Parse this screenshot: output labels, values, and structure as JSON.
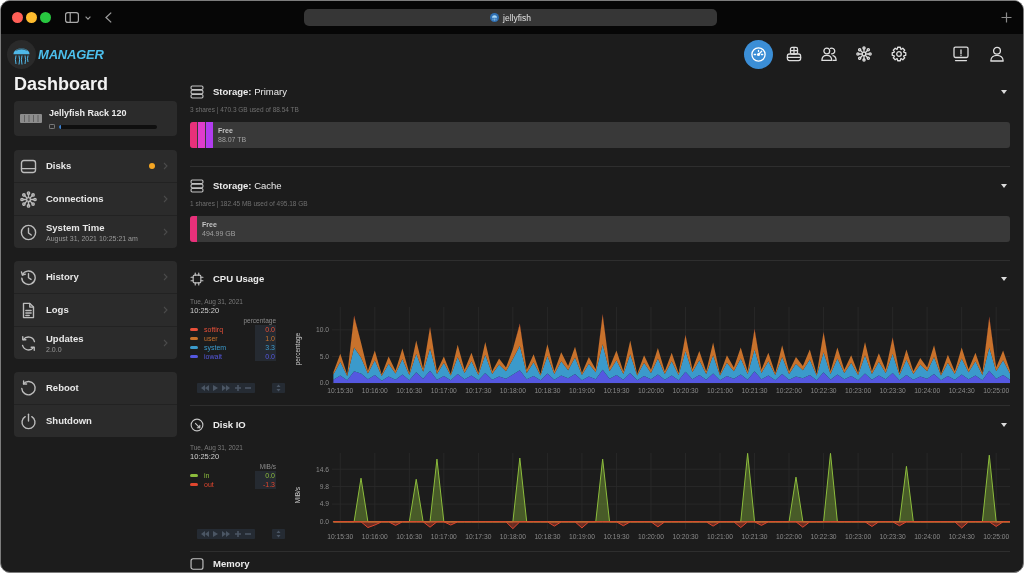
{
  "browser": {
    "url": "jellyfish"
  },
  "app": {
    "logo": "MANAGER"
  },
  "nav": [
    {
      "selected": true
    },
    {
      "selected": false
    },
    {
      "selected": false
    },
    {
      "selected": false
    },
    {
      "selected": false
    }
  ],
  "sidebar": {
    "title": "Dashboard",
    "device": {
      "name": "Jellyfish Rack 120",
      "level": 0.02
    },
    "groups": [
      {
        "kind": "nav",
        "items": [
          {
            "label": "Disks",
            "alert": true
          },
          {
            "label": "Connections",
            "alert": false
          },
          {
            "label": "System Time",
            "detail": "August 31, 2021 10:25:21 am",
            "alert": false
          }
        ]
      },
      {
        "kind": "nav",
        "items": [
          {
            "label": "History",
            "alert": false
          },
          {
            "label": "Logs",
            "alert": false
          },
          {
            "label": "Updates",
            "detail": "2.0.0",
            "alert": false
          }
        ]
      },
      {
        "kind": "action",
        "items": [
          {
            "label": "Reboot",
            "alert": false
          },
          {
            "label": "Shutdown",
            "alert": false
          }
        ]
      }
    ]
  },
  "sections": [
    {
      "kind": "storage",
      "title": "**Storage:** Primary",
      "summary": "3 shares | 470.3 GB used of 88.54 TB",
      "segments": [
        {
          "color": "#e8307a"
        },
        {
          "color": "#e03ccc"
        },
        {
          "color": "#b23cf0"
        }
      ],
      "free_label": "Free",
      "free_value": "88.07 TB"
    },
    {
      "kind": "storage",
      "title": "**Storage:** Cache",
      "summary": "1 shares | 182.45 MB used of 495.18 GB",
      "segments": [
        {
          "color": "#e8307a"
        }
      ],
      "free_label": "Free",
      "free_value": "494.99 GB"
    },
    {
      "kind": "chart",
      "title": "CPU Usage",
      "date": "Tue, Aug 31, 2021",
      "time": "10:25:20",
      "unit": "percentage",
      "readings": [
        "0.0",
        "1.0",
        "3.3",
        "0.0"
      ],
      "chart_data": {
        "type": "area",
        "ylabel": "percentage",
        "stacked": true,
        "grid": true,
        "ylim": [
          0,
          14.3
        ],
        "yticks": [
          {
            "value": 0,
            "label": "0.0"
          },
          {
            "value": 5,
            "label": "5.0"
          },
          {
            "value": 10,
            "label": "10.0"
          }
        ],
        "categories": [
          null,
          "10:15:30",
          null,
          null,
          null,
          null,
          "10:16:00",
          null,
          null,
          null,
          null,
          "10:16:30",
          null,
          null,
          null,
          null,
          "10:17:00",
          null,
          null,
          null,
          null,
          "10:17:30",
          null,
          null,
          null,
          null,
          "10:18:00",
          null,
          null,
          null,
          null,
          "10:18:30",
          null,
          null,
          null,
          null,
          "10:19:00",
          null,
          null,
          null,
          null,
          "10:19:30",
          null,
          null,
          null,
          null,
          "10:20:00",
          null,
          null,
          null,
          null,
          "10:20:30",
          null,
          null,
          null,
          null,
          "10:21:00",
          null,
          null,
          null,
          null,
          "10:21:30",
          null,
          null,
          null,
          null,
          "10:22:00",
          null,
          null,
          null,
          null,
          "10:22:30",
          null,
          null,
          null,
          null,
          "10:23:00",
          null,
          null,
          null,
          null,
          "10:23:30",
          null,
          null,
          null,
          null,
          "10:24:00",
          null,
          null,
          null,
          null,
          "10:24:30",
          null,
          null,
          null,
          null,
          "10:25:00",
          null,
          null
        ],
        "series": [
          {
            "name": "softirq",
            "color": "#e8503a",
            "values": [
              0,
              0,
              0,
              0.2,
              0,
              0,
              0,
              0,
              0,
              0,
              0,
              0,
              0,
              0,
              0.1,
              0,
              0,
              0,
              0,
              0,
              0,
              0,
              0,
              0,
              0,
              0,
              0,
              0.2,
              0,
              0,
              0,
              0,
              0,
              0,
              0,
              0,
              0,
              0,
              0,
              0.2,
              0,
              0,
              0,
              0,
              0,
              0,
              0,
              0,
              0,
              0,
              0,
              0.1,
              0,
              0,
              0,
              0,
              0,
              0,
              0,
              0,
              0,
              0.2,
              0,
              0,
              0,
              0,
              0,
              0,
              0,
              0,
              0,
              0.1,
              0,
              0,
              0,
              0,
              0,
              0,
              0,
              0,
              0,
              0.1,
              0,
              0,
              0,
              0,
              0,
              0,
              0,
              0,
              0,
              0,
              0,
              0,
              0,
              0.2,
              0,
              0,
              0
            ]
          },
          {
            "name": "user",
            "color": "#c8722c",
            "values": [
              0.4,
              1.5,
              0.3,
              5.8,
              2.8,
              0.5,
              1.8,
              0.3,
              1.4,
              0.5,
              2.0,
              0.4,
              2.5,
              0.6,
              4.0,
              0.5,
              1.2,
              0.3,
              2.3,
              0.6,
              1.6,
              0.4,
              2.4,
              0.5,
              1.1,
              0.7,
              1.9,
              4.0,
              0.6,
              1.5,
              0.3,
              2.2,
              0.5,
              1.7,
              0.8,
              2.0,
              0.4,
              1.3,
              0.6,
              5.5,
              0.7,
              1.8,
              0.5,
              2.6,
              0.3,
              1.4,
              0.6,
              2.0,
              0.5,
              1.6,
              0.4,
              3.0,
              0.6,
              1.7,
              0.5,
              2.4,
              0.3,
              1.4,
              0.7,
              2.1,
              0.5,
              3.7,
              0.6,
              1.6,
              0.4,
              2.2,
              0.5,
              1.3,
              0.8,
              1.9,
              0.3,
              3.7,
              0.5,
              2.1,
              0.6,
              1.4,
              0.4,
              2.5,
              0.5,
              1.6,
              0.6,
              3.0,
              0.4,
              1.9,
              0.5,
              1.2,
              0.7,
              2.2,
              0.3,
              1.5,
              0.5,
              2.1,
              0.6,
              1.6,
              0.4,
              5.6,
              0.7,
              1.8,
              0.5
            ]
          },
          {
            "name": "system",
            "color": "#3b9acb",
            "values": [
              1.0,
              2.6,
              0.8,
              4.5,
              3.0,
              1.1,
              2.8,
              0.9,
              2.4,
              1.2,
              2.9,
              1.0,
              3.5,
              1.3,
              4.2,
              1.1,
              2.5,
              0.9,
              3.2,
              1.2,
              2.7,
              1.0,
              3.4,
              1.1,
              2.3,
              1.4,
              2.9,
              4.6,
              1.2,
              2.6,
              0.9,
              3.3,
              1.1,
              2.7,
              1.5,
              3.1,
              1.0,
              2.4,
              1.3,
              4.8,
              1.4,
              2.8,
              1.1,
              3.5,
              0.9,
              2.5,
              1.2,
              3.0,
              1.1,
              2.7,
              1.0,
              3.9,
              1.3,
              2.8,
              1.1,
              3.4,
              0.9,
              2.5,
              1.4,
              3.0,
              1.1,
              4.1,
              1.2,
              2.7,
              1.0,
              3.2,
              1.1,
              2.4,
              1.5,
              2.9,
              0.9,
              3.8,
              1.1,
              3.0,
              1.2,
              2.5,
              1.0,
              3.4,
              1.1,
              2.6,
              1.2,
              3.6,
              1.0,
              2.9,
              1.1,
              2.3,
              1.4,
              3.2,
              0.9,
              2.5,
              1.1,
              3.0,
              1.3,
              2.7,
              1.0,
              4.4,
              1.4,
              2.8,
              1.2
            ]
          },
          {
            "name": "iowait",
            "color": "#5558e0",
            "values": [
              0.6,
              1.4,
              0.5,
              2.2,
              1.8,
              0.7,
              1.5,
              0.4,
              1.2,
              0.6,
              1.6,
              0.5,
              2.0,
              0.8,
              2.3,
              0.6,
              1.3,
              0.5,
              1.7,
              0.7,
              1.4,
              0.5,
              1.9,
              0.6,
              1.2,
              0.8,
              1.6,
              2.4,
              0.7,
              1.3,
              0.5,
              1.8,
              0.6,
              1.4,
              0.9,
              1.7,
              0.5,
              1.2,
              0.7,
              2.5,
              0.8,
              1.5,
              0.6,
              1.9,
              0.5,
              1.3,
              0.7,
              1.6,
              0.6,
              1.4,
              0.5,
              2.1,
              0.7,
              1.5,
              0.6,
              1.8,
              0.5,
              1.3,
              0.8,
              1.6,
              0.6,
              2.2,
              0.7,
              1.4,
              0.5,
              1.7,
              0.6,
              1.2,
              0.9,
              1.5,
              0.5,
              2.0,
              0.6,
              1.6,
              0.7,
              1.3,
              0.5,
              1.8,
              0.6,
              1.4,
              0.7,
              1.9,
              0.5,
              1.5,
              0.6,
              1.2,
              0.8,
              1.7,
              0.5,
              1.3,
              0.6,
              1.6,
              0.7,
              1.4,
              0.5,
              2.3,
              0.8,
              1.5,
              0.6
            ]
          }
        ]
      }
    },
    {
      "kind": "chart",
      "title": "Disk IO",
      "date": "Tue, Aug 31, 2021",
      "time": "10:25:20",
      "unit": "MiB/s",
      "readings": [
        "0.0",
        "-1.3"
      ],
      "chart_data": {
        "type": "area",
        "ylabel": "MiB/s",
        "stacked": false,
        "grid": true,
        "ylim": [
          -2,
          19.1
        ],
        "yticks": [
          {
            "value": 0,
            "label": "0.0"
          },
          {
            "value": 4.9,
            "label": "4.9"
          },
          {
            "value": 9.8,
            "label": "9.8"
          },
          {
            "value": 14.6,
            "label": "14.6"
          }
        ],
        "categories": [
          null,
          "10:15:30",
          null,
          null,
          null,
          null,
          "10:16:00",
          null,
          null,
          null,
          null,
          "10:16:30",
          null,
          null,
          null,
          null,
          "10:17:00",
          null,
          null,
          null,
          null,
          "10:17:30",
          null,
          null,
          null,
          null,
          "10:18:00",
          null,
          null,
          null,
          null,
          "10:18:30",
          null,
          null,
          null,
          null,
          "10:19:00",
          null,
          null,
          null,
          null,
          "10:19:30",
          null,
          null,
          null,
          null,
          "10:20:00",
          null,
          null,
          null,
          null,
          "10:20:30",
          null,
          null,
          null,
          null,
          "10:21:00",
          null,
          null,
          null,
          null,
          "10:21:30",
          null,
          null,
          null,
          null,
          "10:22:00",
          null,
          null,
          null,
          null,
          "10:22:30",
          null,
          null,
          null,
          null,
          "10:23:00",
          null,
          null,
          null,
          null,
          "10:23:30",
          null,
          null,
          null,
          null,
          "10:24:00",
          null,
          null,
          null,
          null,
          "10:24:30",
          null,
          null,
          null,
          null,
          "10:25:00",
          null,
          null
        ],
        "series": [
          {
            "name": "in",
            "color": "#8cbc3c",
            "values": [
              0,
              0,
              0,
              0,
              12.1,
              0,
              0,
              0,
              0,
              0,
              0,
              0,
              11.8,
              0,
              0,
              17.4,
              0,
              0,
              0,
              0,
              0,
              0,
              0,
              0,
              0,
              0,
              0,
              17.7,
              0,
              0,
              0,
              0,
              0,
              0,
              0,
              0,
              0,
              0,
              0,
              17.4,
              0,
              0,
              0,
              0,
              0,
              0,
              0,
              0,
              0,
              0,
              0,
              0,
              0,
              0,
              0,
              0,
              0,
              0,
              0,
              0,
              19.0,
              0,
              0,
              0,
              0,
              0,
              0,
              12.4,
              0,
              0,
              0,
              0,
              19.0,
              0,
              0,
              0,
              0,
              0,
              0,
              0,
              0,
              0,
              0,
              15.4,
              0,
              0,
              0,
              0,
              0,
              0,
              0,
              0,
              0,
              0,
              0,
              18.5,
              0,
              0,
              0
            ]
          },
          {
            "name": "out",
            "color": "#e0462e",
            "values": [
              0,
              0,
              0,
              0,
              0,
              -1.6,
              -0.9,
              0,
              0,
              -1.0,
              0,
              0,
              0,
              0,
              -1.5,
              0,
              0,
              -0.9,
              0,
              0,
              0,
              0,
              0,
              0,
              0,
              0,
              -1.9,
              0,
              0,
              0,
              0,
              0,
              -1.2,
              0,
              0,
              0,
              -1.7,
              0,
              0,
              0,
              0,
              0,
              -1.1,
              0,
              0,
              0,
              0,
              -1.4,
              0,
              0,
              0,
              0,
              0,
              0,
              0,
              -1.2,
              0,
              0,
              0,
              -1.6,
              0,
              0,
              -1.0,
              0,
              0,
              0,
              0,
              0,
              -1.5,
              0,
              0,
              0,
              0,
              0,
              0,
              0,
              0,
              0,
              -1.3,
              0,
              0,
              0,
              -1.1,
              0,
              0,
              0,
              0,
              0,
              0,
              0,
              0,
              -1.7,
              0,
              0,
              0,
              0,
              -1.3,
              0,
              0
            ]
          }
        ]
      }
    },
    {
      "kind": "heading",
      "title": "Memory"
    }
  ]
}
